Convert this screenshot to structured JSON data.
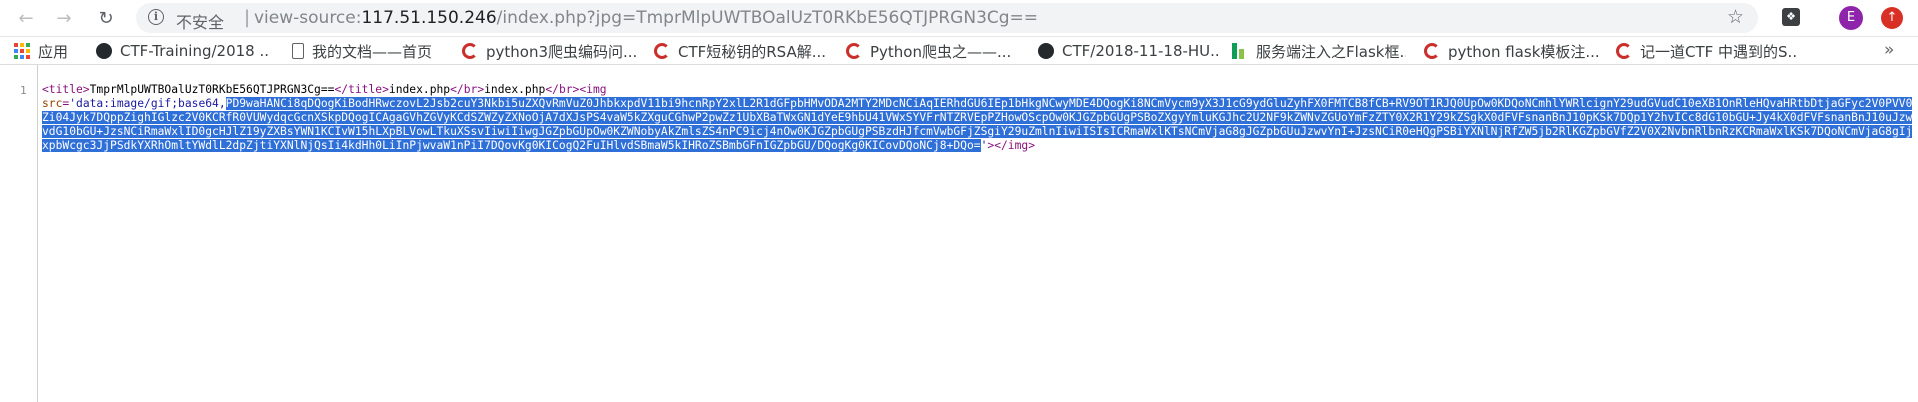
{
  "toolbar": {
    "back_icon": "arrow-left-icon",
    "forward_icon": "arrow-right-icon",
    "reload_icon": "reload-icon",
    "security_label": "不安全",
    "url_scheme": "view-source:",
    "url_host": "117.51.150.246",
    "url_path": "/index.php?jpg=TmprMlpUWTBOalUzT0RKbE56QTJPRGN3Cg==",
    "avatar_letter": "E"
  },
  "bookmarks": [
    {
      "label": "应用",
      "icon": "apps-icon"
    },
    {
      "label": "CTF-Training/2018 ...",
      "icon": "github-icon"
    },
    {
      "label": "我的文档——首页",
      "icon": "document-icon"
    },
    {
      "label": "python3爬虫编码问...",
      "icon": "csdn-icon"
    },
    {
      "label": "CTF短秘钥的RSA解...",
      "icon": "csdn-icon"
    },
    {
      "label": "Python爬虫之——...",
      "icon": "csdn-icon"
    },
    {
      "label": "CTF/2018-11-18-HU...",
      "icon": "github-icon"
    },
    {
      "label": "服务端注入之Flask框...",
      "icon": "sheet-icon"
    },
    {
      "label": "python flask模板注...",
      "icon": "csdn-icon"
    },
    {
      "label": "记一道CTF 中遇到的S...",
      "icon": "csdn-icon"
    }
  ],
  "bookmarks_more": "»",
  "source": {
    "line_number": "1",
    "title_open": "<title>",
    "title_text": "TmprMlpUWTBOalUzT0RKbE56QTJPRGN3Cg==",
    "title_close": "</title>",
    "text1": "index.php",
    "br_close1": "</br>",
    "text2": "index.php",
    "br_close2": "</br>",
    "img_open": "<img",
    "attr_name": "src",
    "attr_prefix": "'data:image/gif;base64,",
    "attr_selected": "PD9waHANCi8qDQogKiBodHRwczovL2Jsb2cuY3Nkbi5uZXQvRmVuZ0JhbkxpdV11bi9hcnRpY2xlL2R1dGFpbHMvODA2MTY2MDcNCiAqIERhdGU6IEp1bHkgNCwyMDE4DQogKi8NCmVycm9yX3J1cG9ydGluZyhFX0FMTCB8fCB+RV9OT1RJQ0UpOw0KDQoNCmhlYWRlcignY29udGVudC10eXB1OnRleHQvaHRtbDtjaGFyc2V0PVV0Zi04Jyk7DQppZighIGlzc2V0KCRfR0VUWydqcGcnXSkpDQogICAgaGVhZGVyKCdSZWZyZXNoOjA7dXJsPS4vaW5kZXguCGhwP2pwZz1UbXBaTWxGN1dYeE9hbU41VWxSYVFrNTZRVEpPZHowOScpOw0KJGZpbGUgPSBoZXgyYmluKGJhc2U2NF9kZWNvZGUoYmFzZTY0X2R1Y29kZSgkX0dFVFsnanBnJ10pKSk7DQp1Y2hvICc8dG10bGU+Jy4kX0dFVFsnanBnJ10uJzwvdG10bGU+JzsNCiRmaWxlID0gcHJlZ19yZXBsYWN1KCIvW15hLXpBLVowLTkuXSsvIiwiIiwgJGZpbGUpOw0KZWNobyAkZmlsZS4nPC9icj4nOw0KJGZpbGUgPSBzdHJfcmVwbGFjZSgiY29uZmlnIiwiISIsICRmaWxlKTsNCmVjaG8gJGZpbGUuJzwvYnI+JzsNCiR0eHQgPSBiYXNlNjRfZW5jb2RlKGZpbGVfZ2V0X2NvbnRlbnRzKCRmaWxlKSk7DQoNCmVjaG8gIjxpbWcgc3JjPSdkYXRhOmltYWdlL2dpZjtiYXNlNjQsIi4kdHh0LiInPjwvaW1nPiI7DQovKg0KICogQ2FuIHlvdSBmaW5kIHRoZSBmbGFnIGZpbGU/DQogKg0KICovDQoNCj8+DQo=",
    "attr_suffix": "'",
    "img_close": "></img>"
  }
}
